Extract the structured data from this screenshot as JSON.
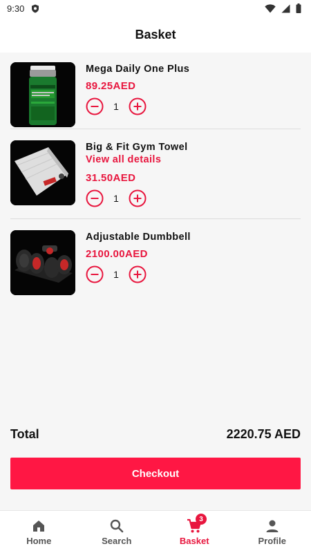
{
  "status_bar": {
    "time": "9:30"
  },
  "header": {
    "title": "Basket"
  },
  "items": [
    {
      "name": "Mega Daily One Plus",
      "link": "",
      "price": "89.25AED",
      "qty": "1"
    },
    {
      "name": "Big & Fit Gym Towel",
      "link": "View all details",
      "price": "31.50AED",
      "qty": "1"
    },
    {
      "name": "Adjustable Dumbbell",
      "link": "",
      "price": "2100.00AED",
      "qty": "1"
    }
  ],
  "total": {
    "label": "Total",
    "value": "2220.75 AED"
  },
  "checkout": {
    "label": "Checkout"
  },
  "nav": {
    "items": [
      {
        "label": "Home",
        "icon": "home-icon"
      },
      {
        "label": "Search",
        "icon": "search-icon"
      },
      {
        "label": "Basket",
        "icon": "cart-icon",
        "badge": "3"
      },
      {
        "label": "Profile",
        "icon": "person-icon"
      }
    ],
    "active": "Basket"
  },
  "colors": {
    "accent": "#e8163e",
    "checkout": "#ff1744",
    "background": "#f6f6f6"
  }
}
